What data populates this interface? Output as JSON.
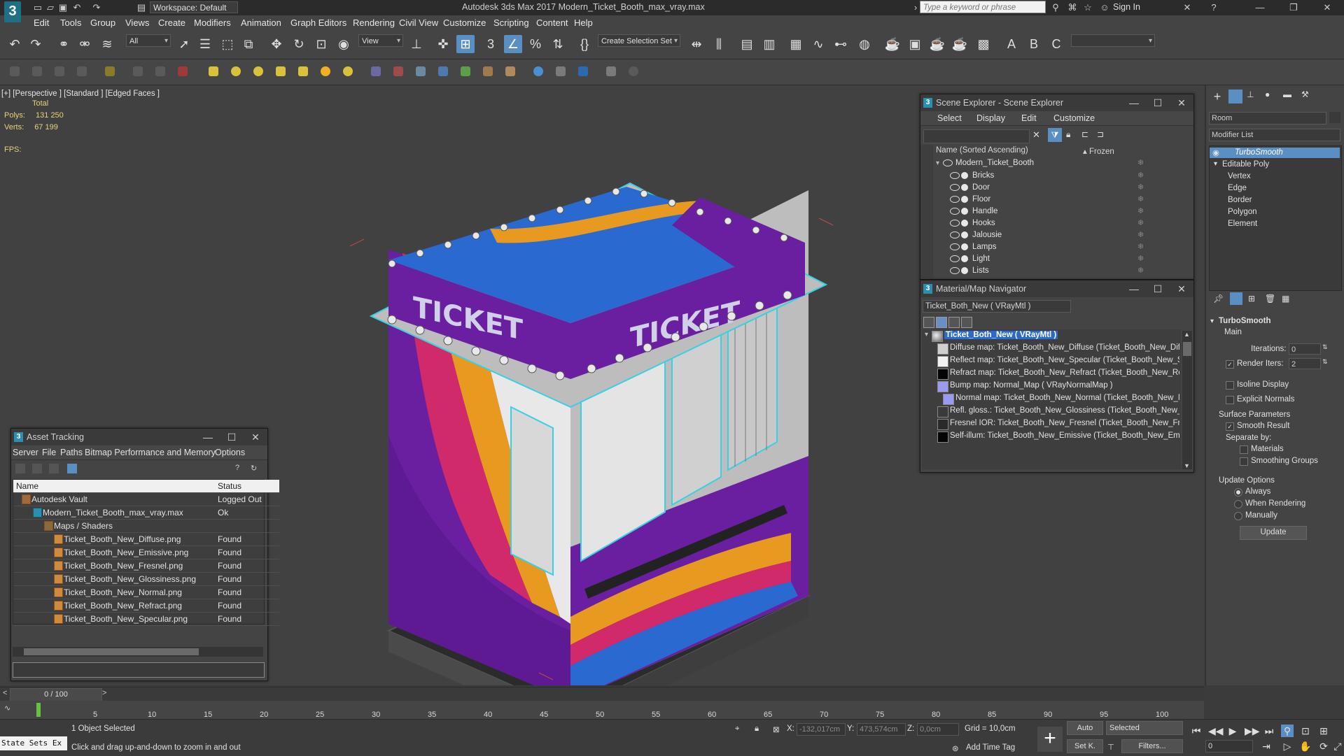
{
  "app": {
    "logo": "3",
    "window_title": "Autodesk 3ds Max 2017      Modern_Ticket_Booth_max_vray.max",
    "workspace": "Workspace: Default",
    "search_placeholder": "Type a keyword or phrase",
    "signin": "Sign In"
  },
  "menu": [
    "Edit",
    "Tools",
    "Group",
    "Views",
    "Create",
    "Modifiers",
    "Animation",
    "Graph Editors",
    "Rendering",
    "Civil View",
    "Customize",
    "Scripting",
    "Content",
    "Help"
  ],
  "toolbar": {
    "selection_filter": "All",
    "ref_coord": "View",
    "named_selection": "Create Selection Set"
  },
  "viewport": {
    "label": "[+] [Perspective ] [Standard ] [Edged Faces ]",
    "stats_header": "Total",
    "polys_label": "Polys:",
    "polys_value": "131 250",
    "verts_label": "Verts:",
    "verts_value": "67 199",
    "fps_label": "FPS:",
    "booth_sign_text": "TICKET"
  },
  "scene_explorer": {
    "title": "Scene Explorer - Scene Explorer",
    "menu": [
      "Select",
      "Display",
      "Edit",
      "Customize"
    ],
    "col_name": "Name (Sorted Ascending)",
    "col_frozen": "▴ Frozen",
    "root": "Modern_Ticket_Booth",
    "items": [
      "Bricks",
      "Door",
      "Floor",
      "Handle",
      "Hooks",
      "Jalousie",
      "Lamps",
      "Light",
      "Lists"
    ]
  },
  "material_navigator": {
    "title": "Material/Map Navigator",
    "current": "Ticket_Both_New  ( VRayMtl )",
    "root": "Ticket_Both_New  ( VRayMtl )",
    "maps": [
      {
        "label": "Diffuse map: Ticket_Booth_New_Diffuse (Ticket_Booth_New_Diffuse.p",
        "swatch": "#cfcfcf"
      },
      {
        "label": "Reflect map: Ticket_Booth_New_Specular (Ticket_Booth_New_Specula",
        "swatch": "#f2f2f2"
      },
      {
        "label": "Refract map: Ticket_Booth_New_Refract (Ticket_Booth_New_Refract.p",
        "swatch": "#050505"
      },
      {
        "label": "Bump map: Normal_Map  ( VRayNormalMap )",
        "swatch": "#9a9af0"
      },
      {
        "label": "Normal map: Ticket_Booth_New_Normal (Ticket_Booth_New_Normal",
        "swatch": "#9a9af0"
      },
      {
        "label": "Refl. gloss.: Ticket_Booth_New_Glossiness (Ticket_Booth_New_Glossin",
        "swatch": "#3a3a3a"
      },
      {
        "label": "Fresnel IOR: Ticket_Booth_New_Fresnel (Ticket_Booth_New_Fresnel.p",
        "swatch": "#2a2a2a"
      },
      {
        "label": "Self-illum: Ticket_Booth_New_Emissive (Ticket_Booth_New_Emissive.p",
        "swatch": "#050505"
      }
    ]
  },
  "asset_tracking": {
    "title": "Asset Tracking",
    "menu": [
      "Server",
      "File",
      "Paths",
      "Bitmap Performance and Memory",
      "Options"
    ],
    "col_name": "Name",
    "col_status": "Status",
    "rows": [
      {
        "name": "Autodesk Vault",
        "status": "Logged Out"
      },
      {
        "name": "Modern_Ticket_Booth_max_vray.max",
        "status": "Ok"
      },
      {
        "name": "Maps / Shaders",
        "status": ""
      },
      {
        "name": "Ticket_Booth_New_Diffuse.png",
        "status": "Found"
      },
      {
        "name": "Ticket_Booth_New_Emissive.png",
        "status": "Found"
      },
      {
        "name": "Ticket_Booth_New_Fresnel.png",
        "status": "Found"
      },
      {
        "name": "Ticket_Booth_New_Glossiness.png",
        "status": "Found"
      },
      {
        "name": "Ticket_Booth_New_Normal.png",
        "status": "Found"
      },
      {
        "name": "Ticket_Booth_New_Refract.png",
        "status": "Found"
      },
      {
        "name": "Ticket_Booth_New_Specular.png",
        "status": "Found"
      }
    ]
  },
  "command_panel": {
    "object_name": "Room",
    "modifier_list": "Modifier List",
    "stack": [
      "TurboSmooth",
      "Editable Poly",
      "Vertex",
      "Edge",
      "Border",
      "Polygon",
      "Element"
    ],
    "rollout_title": "TurboSmooth",
    "main_label": "Main",
    "iterations_label": "Iterations:",
    "iterations_value": "0",
    "render_iters_label": "Render Iters:",
    "render_iters_value": "2",
    "isoline_label": "Isoline Display",
    "explicit_normals_label": "Explicit Normals",
    "surface_params_label": "Surface Parameters",
    "smooth_result_label": "Smooth Result",
    "separate_by_label": "Separate by:",
    "materials_label": "Materials",
    "smoothing_groups_label": "Smoothing Groups",
    "update_options_label": "Update Options",
    "always_label": "Always",
    "when_rendering_label": "When Rendering",
    "manually_label": "Manually",
    "update_button": "Update"
  },
  "timeline": {
    "frame": "0 / 100",
    "ticks": [
      "5",
      "10",
      "15",
      "20",
      "25",
      "30",
      "35",
      "40",
      "45",
      "50",
      "55",
      "60",
      "65",
      "70",
      "75",
      "80",
      "85",
      "90",
      "95",
      "100"
    ]
  },
  "status": {
    "state_sets": "State Sets Ex",
    "selected": "1 Object Selected",
    "prompt": "Click and drag up-and-down to zoom in and out",
    "x_label": "X:",
    "x_value": "-132,017cm",
    "y_label": "Y:",
    "y_value": "473,574cm",
    "z_label": "Z:",
    "z_value": "0,0cm",
    "grid": "Grid = 10,0cm",
    "add_time_tag": "Add Time Tag",
    "auto": "Auto",
    "set_k": "Set K.",
    "selected_dd": "Selected",
    "filters": "Filters...",
    "frame_field": "0"
  }
}
